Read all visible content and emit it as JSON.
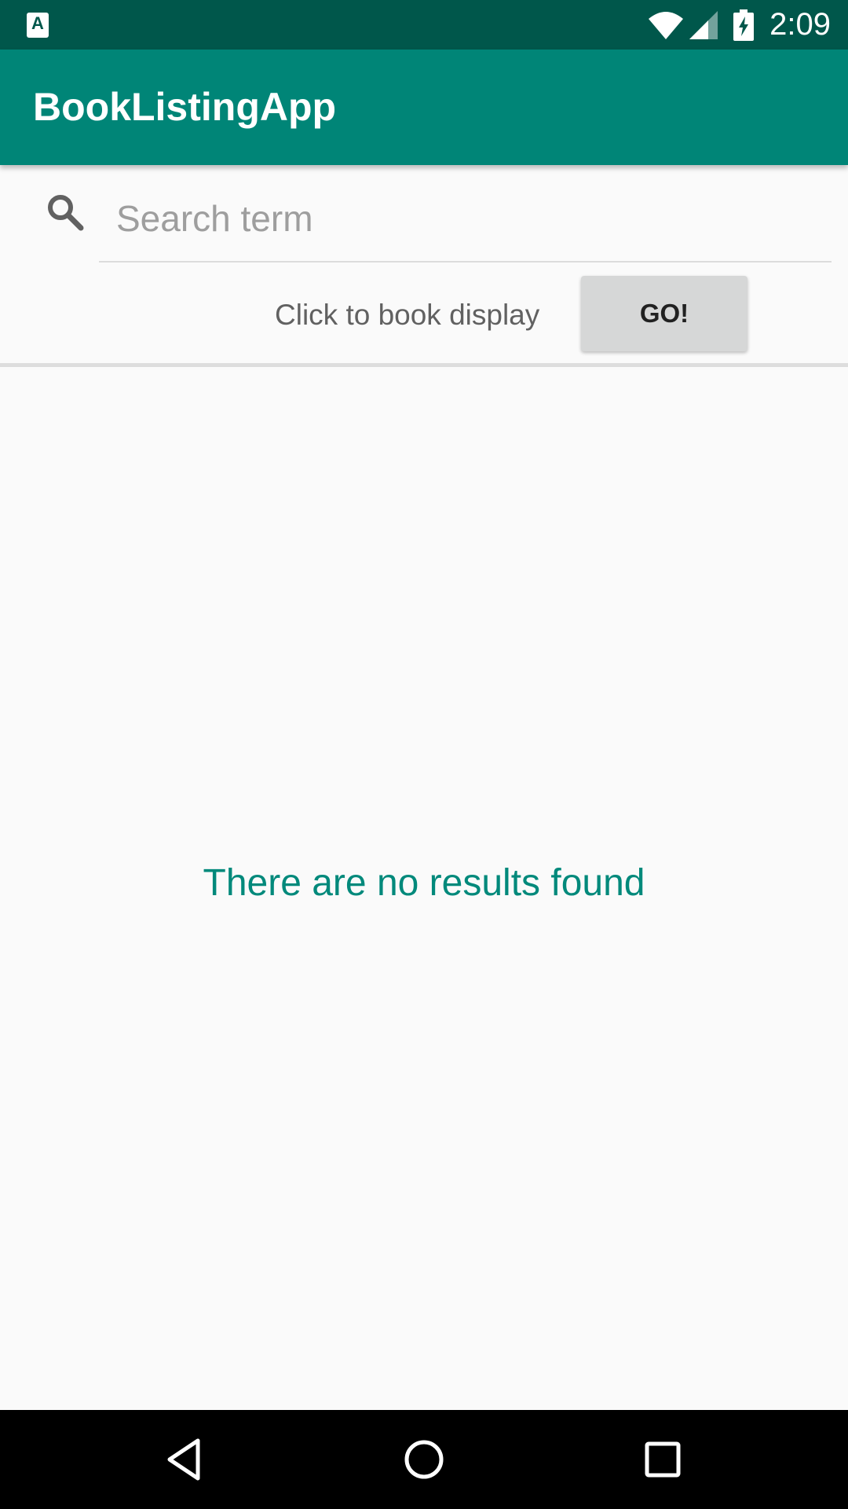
{
  "status_bar": {
    "time": "2:09",
    "app_icon_letter": "A",
    "icons": [
      "wifi-icon",
      "cell-signal-icon",
      "battery-charging-icon"
    ]
  },
  "app_bar": {
    "title": "BookListingApp",
    "color": "#008577"
  },
  "search": {
    "placeholder": "Search term",
    "value": "",
    "icon": "search-icon"
  },
  "actions": {
    "hint": "Click to book display",
    "go_label": "GO!"
  },
  "empty_state": {
    "message": "There are no results found",
    "color": "#00897b"
  },
  "nav_bar": {
    "buttons": [
      "back-icon",
      "home-icon",
      "recents-icon"
    ]
  }
}
